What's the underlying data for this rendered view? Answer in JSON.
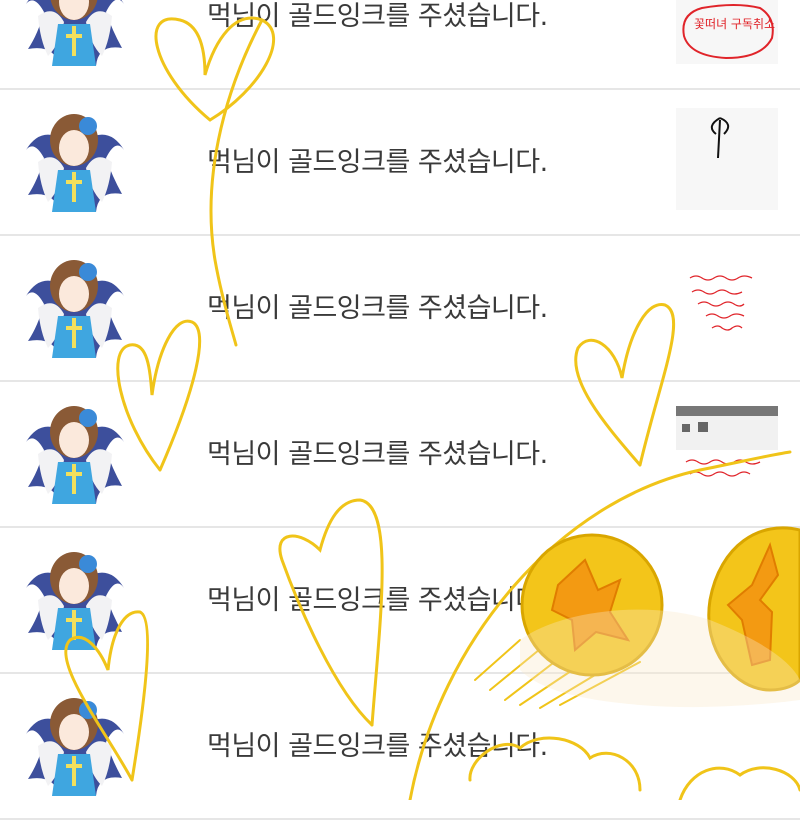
{
  "notifications": [
    {
      "text": "먹님이 골드잉크를 주셨습니다.",
      "thumb_scribble": "꽃떠녀 구독취소"
    },
    {
      "text": "먹님이 골드잉크를 주셨습니다.",
      "thumb_scribble": ""
    },
    {
      "text": "먹님이 골드잉크를 주셨습니다.",
      "thumb_scribble": ""
    },
    {
      "text": "먹님이 골드잉크를 주셨습니다.",
      "thumb_scribble": ""
    },
    {
      "text": "먹님이 골드잉크를 주셨습니다.",
      "thumb_scribble": ""
    },
    {
      "text": "먹님이 골드잉크를 주셨습니다.",
      "thumb_scribble": ""
    }
  ],
  "colors": {
    "doodle_yellow": "#f0c419",
    "coin_gold": "#f3c51a",
    "coin_orange": "#f39a12"
  }
}
